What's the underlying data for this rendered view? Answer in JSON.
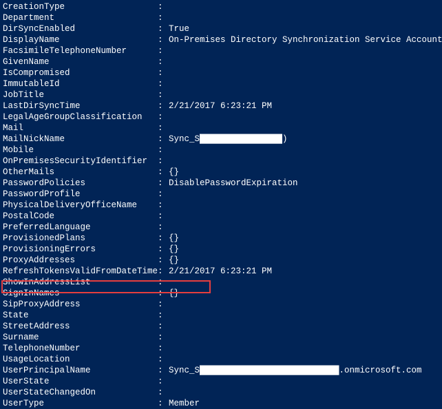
{
  "rows": [
    {
      "key": "CreationType",
      "value": ""
    },
    {
      "key": "Department",
      "value": ""
    },
    {
      "key": "DirSyncEnabled",
      "value": "True"
    },
    {
      "key": "DisplayName",
      "value": "On-Premises Directory Synchronization Service Account"
    },
    {
      "key": "FacsimileTelephoneNumber",
      "value": ""
    },
    {
      "key": "GivenName",
      "value": ""
    },
    {
      "key": "IsCompromised",
      "value": ""
    },
    {
      "key": "ImmutableId",
      "value": ""
    },
    {
      "key": "JobTitle",
      "value": ""
    },
    {
      "key": "LastDirSyncTime",
      "value": "2/21/2017 6:23:21 PM"
    },
    {
      "key": "LegalAgeGroupClassification",
      "value": ""
    },
    {
      "key": "Mail",
      "value": ""
    },
    {
      "key": "MailNickName",
      "value": "Sync_S████████████████)"
    },
    {
      "key": "Mobile",
      "value": ""
    },
    {
      "key": "OnPremisesSecurityIdentifier",
      "value": ""
    },
    {
      "key": "OtherMails",
      "value": "{}"
    },
    {
      "key": "PasswordPolicies",
      "value": "DisablePasswordExpiration"
    },
    {
      "key": "PasswordProfile",
      "value": ""
    },
    {
      "key": "PhysicalDeliveryOfficeName",
      "value": ""
    },
    {
      "key": "PostalCode",
      "value": ""
    },
    {
      "key": "PreferredLanguage",
      "value": ""
    },
    {
      "key": "ProvisionedPlans",
      "value": "{}"
    },
    {
      "key": "ProvisioningErrors",
      "value": "{}"
    },
    {
      "key": "ProxyAddresses",
      "value": "{}"
    },
    {
      "key": "RefreshTokensValidFromDateTime",
      "value": "2/21/2017 6:23:21 PM"
    },
    {
      "key": "ShowInAddressList",
      "value": ""
    },
    {
      "key": "SignInNames",
      "value": "{}"
    },
    {
      "key": "SipProxyAddress",
      "value": ""
    },
    {
      "key": "State",
      "value": ""
    },
    {
      "key": "StreetAddress",
      "value": ""
    },
    {
      "key": "Surname",
      "value": ""
    },
    {
      "key": "TelephoneNumber",
      "value": ""
    },
    {
      "key": "UsageLocation",
      "value": ""
    },
    {
      "key": "UserPrincipalName",
      "value": "Sync_S███████████████████████████.onmicrosoft.com"
    },
    {
      "key": "UserState",
      "value": ""
    },
    {
      "key": "UserStateChangedOn",
      "value": ""
    },
    {
      "key": "UserType",
      "value": "Member"
    }
  ],
  "highlightedKey": "ShowInAddressList"
}
